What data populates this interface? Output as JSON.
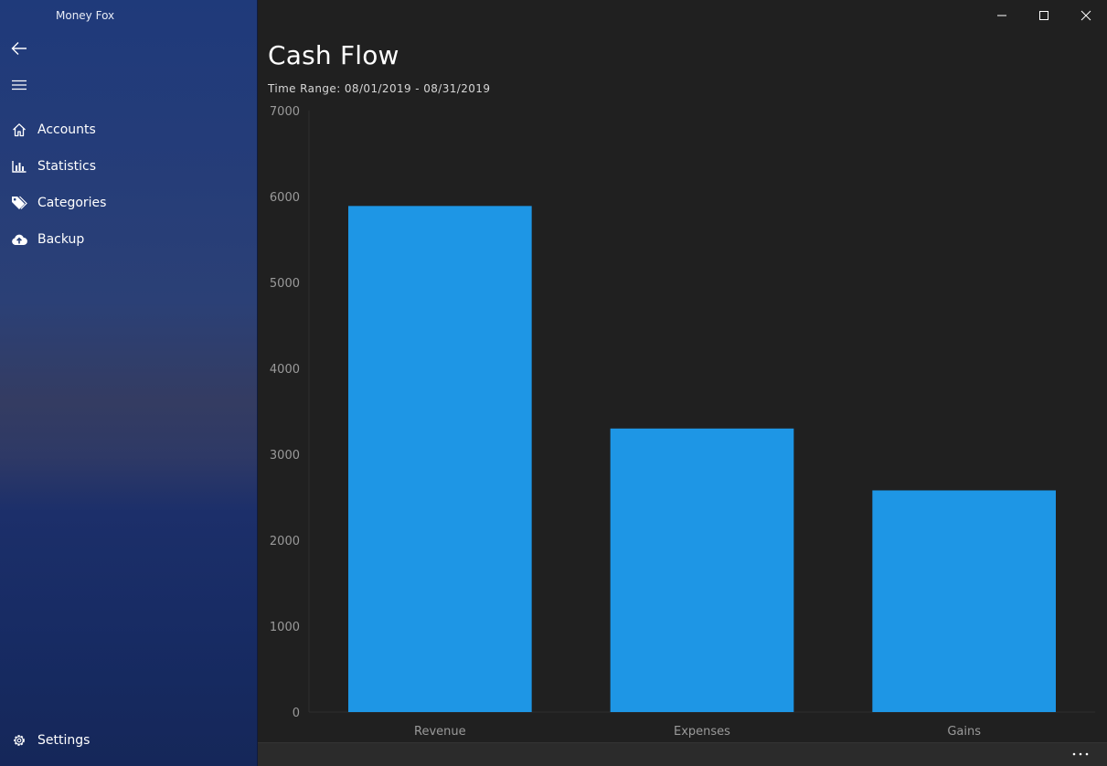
{
  "app": {
    "title": "Money Fox"
  },
  "sidebar": {
    "back_icon": "back-arrow-icon",
    "menu_icon": "hamburger-icon",
    "items": [
      {
        "label": "Accounts",
        "icon": "home-icon"
      },
      {
        "label": "Statistics",
        "icon": "bar-chart-icon"
      },
      {
        "label": "Categories",
        "icon": "tag-icon"
      },
      {
        "label": "Backup",
        "icon": "cloud-upload-icon"
      }
    ],
    "settings": {
      "label": "Settings",
      "icon": "gear-icon"
    }
  },
  "window_controls": [
    "minimize-icon",
    "maximize-icon",
    "close-icon"
  ],
  "page": {
    "title": "Cash Flow",
    "time_range_label": "Time Range:",
    "time_range_value": "08/01/2019 - 08/31/2019"
  },
  "colors": {
    "bar": "#1e96e5",
    "background": "#202020",
    "axis_text": "#9a9a9a",
    "sidebar_top": "#1f3a7a",
    "sidebar_bottom": "#152759"
  },
  "chart_data": {
    "type": "bar",
    "categories": [
      "Revenue",
      "Expenses",
      "Gains"
    ],
    "values": [
      5890,
      3300,
      2580
    ],
    "ylim": [
      0,
      7000
    ],
    "yticks": [
      0,
      1000,
      2000,
      3000,
      4000,
      5000,
      6000,
      7000
    ],
    "grid": false,
    "title": "",
    "xlabel": "",
    "ylabel": ""
  },
  "bottom_bar": {
    "more_icon": "more-ellipsis-icon"
  }
}
